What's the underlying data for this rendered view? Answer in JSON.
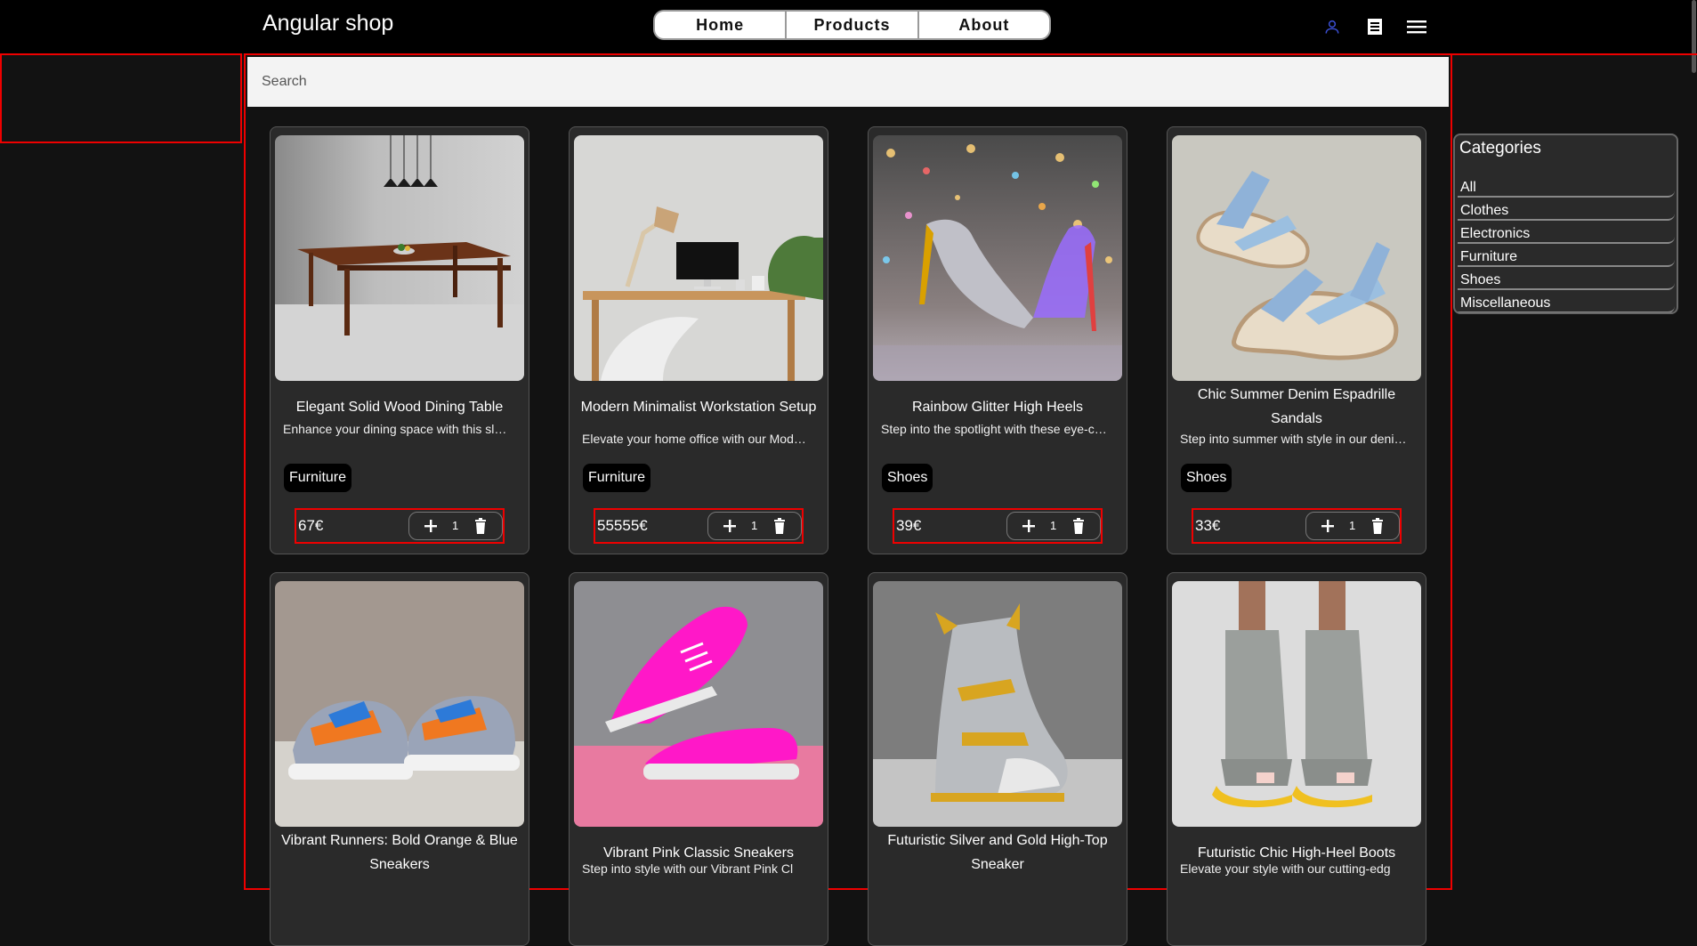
{
  "app": {
    "title": "Angular shop"
  },
  "nav": {
    "home": "Home",
    "products": "Products",
    "about": "About"
  },
  "toolbar": {
    "account_icon": "account-icon",
    "receipt_icon": "receipt-icon",
    "menu_icon": "menu-icon"
  },
  "colors": {
    "accent": "#3b4fd4",
    "outline": "#ee0000",
    "card": "#2a2a2a"
  },
  "search": {
    "placeholder": "Search"
  },
  "products": [
    {
      "title": "Elegant Solid Wood Dining Table",
      "description": "Enhance your dining space with this sl…",
      "category": "Furniture",
      "price": "67€",
      "quantity": "1",
      "image": "wood-dining-table-photo"
    },
    {
      "title": "Modern Minimalist Workstation Setup",
      "description": "Elevate your home office with our Mod…",
      "category": "Furniture",
      "price": "55555€",
      "quantity": "1",
      "image": "desk-workstation-photo"
    },
    {
      "title": "Rainbow Glitter High Heels",
      "description": "Step into the spotlight with these eye-c…",
      "category": "Shoes",
      "price": "39€",
      "quantity": "1",
      "image": "glitter-heels-photo"
    },
    {
      "title": "Chic Summer Denim Espadrille Sandals",
      "description": "Step into summer with style in our deni…",
      "category": "Shoes",
      "price": "33€",
      "quantity": "1",
      "image": "denim-sandals-photo"
    },
    {
      "title": "Vibrant Runners: Bold Orange & Blue Sneakers",
      "description": "",
      "image": "orange-blue-sneakers-photo"
    },
    {
      "title": "Vibrant Pink Classic Sneakers",
      "description": "Step into style with our Vibrant Pink Cl",
      "image": "pink-sneakers-photo"
    },
    {
      "title": "Futuristic Silver and Gold High-Top Sneaker",
      "description": "",
      "image": "silver-gold-sneaker-photo"
    },
    {
      "title": "Futuristic Chic High-Heel Boots",
      "description": "Elevate your style with our cutting-edg",
      "image": "heel-boots-photo"
    }
  ],
  "categories": {
    "title": "Categories",
    "items": [
      "All",
      "Clothes",
      "Electronics",
      "Furniture",
      "Shoes",
      "Miscellaneous"
    ]
  }
}
